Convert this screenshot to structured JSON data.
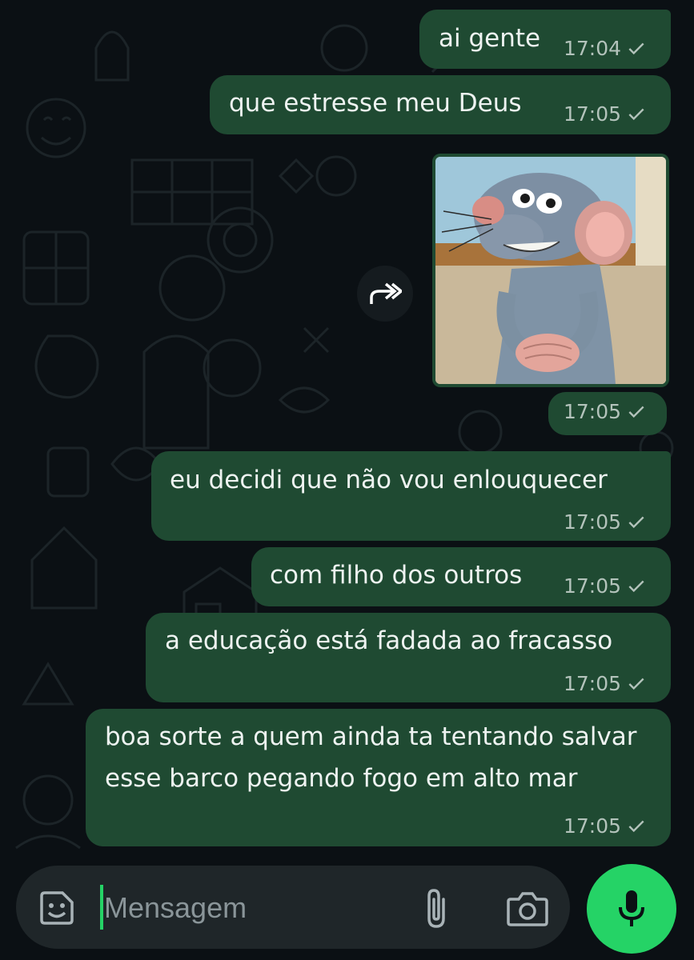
{
  "messages": [
    {
      "text": "ai gente",
      "time": "17:04"
    },
    {
      "text": "que estresse meu Deus",
      "time": "17:05"
    },
    {
      "media": "gif-rat-image",
      "time": "17:05"
    },
    {
      "text": "eu decidi que não vou enlouquecer",
      "time": "17:05"
    },
    {
      "text": "com filho dos outros",
      "time": "17:05"
    },
    {
      "text": "a educação está fadada ao fracasso",
      "time": "17:05"
    },
    {
      "text": "boa sorte a quem ainda ta tentando salvar esse barco pegando fogo em alto mar",
      "time": "17:05"
    }
  ],
  "composer": {
    "placeholder": "Mensagem",
    "sticker_icon": "sticker-icon",
    "attach_icon": "paperclip-icon",
    "camera_icon": "camera-icon",
    "mic_icon": "microphone-icon"
  },
  "colors": {
    "background": "#0b1014",
    "outgoing_bubble": "#1f4a32",
    "accent": "#25d366",
    "input_bar": "#1f2629"
  }
}
